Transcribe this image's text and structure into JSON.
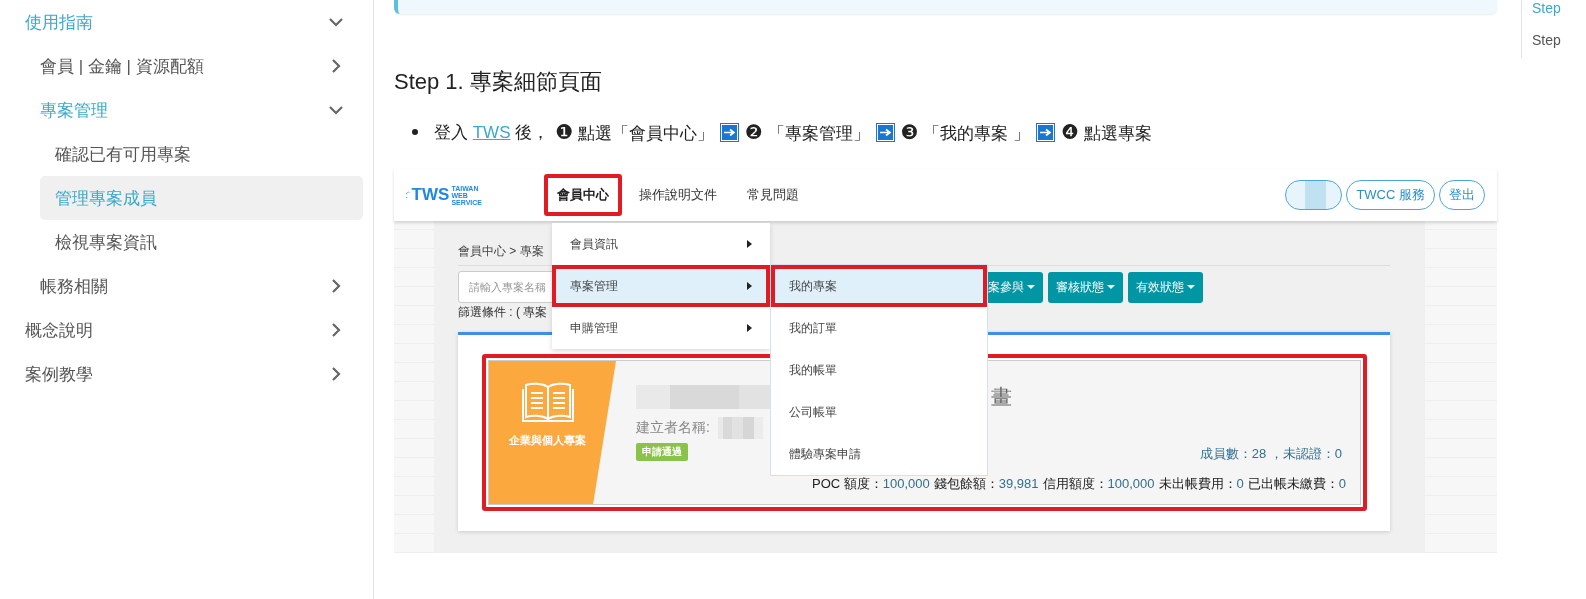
{
  "sidebar": {
    "items": [
      {
        "label": "使用指南",
        "selected": false,
        "expanded": true,
        "children": [
          {
            "label": "會員 | 金鑰 | 資源配額",
            "selected": false,
            "expanded": false
          },
          {
            "label": "專案管理",
            "selected": false,
            "expanded": true,
            "children": [
              {
                "label": "確認已有可用專案",
                "selected": false
              },
              {
                "label": "管理專案成員",
                "selected": true
              },
              {
                "label": "檢視專案資訊",
                "selected": false
              }
            ]
          },
          {
            "label": "帳務相關",
            "selected": false,
            "expanded": false
          }
        ]
      },
      {
        "label": "概念說明",
        "selected": false,
        "expanded": false
      },
      {
        "label": "案例教學",
        "selected": false,
        "expanded": false
      }
    ]
  },
  "article": {
    "heading": "Step 1. 專案細節頁面",
    "instruction": {
      "prefix": "登入 ",
      "link": "TWS",
      "suffix": " 後，",
      "steps": [
        {
          "number": "❶",
          "text": "點選「會員中心」",
          "arrow": true
        },
        {
          "number": "❷",
          "text": "「專案管理」",
          "arrow": true
        },
        {
          "number": "❸",
          "text": "「我的專案 」",
          "arrow": true
        },
        {
          "number": "❹",
          "text": "點選專案",
          "arrow": false
        }
      ]
    }
  },
  "screenshot": {
    "logo": {
      "name": "TWS",
      "tagline": [
        "TAIWAN",
        "WEB",
        "SERVICE"
      ]
    },
    "nav": [
      {
        "label": "會員中心",
        "selected": true,
        "highlighted": true
      },
      {
        "label": "操作說明文件",
        "selected": false,
        "highlighted": false
      },
      {
        "label": "常見問題",
        "selected": false,
        "highlighted": false
      }
    ],
    "account_buttons": [
      {
        "kind": "redacted"
      },
      {
        "kind": "text",
        "label": "TWCC 服務"
      },
      {
        "kind": "text",
        "label": "登出"
      }
    ],
    "breadcrumb": "會員中心 > 專案",
    "search": {
      "placeholder": "請輸入專案名稱"
    },
    "filter_buttons": [
      "案參與",
      "審核狀態",
      "有效狀態"
    ],
    "filter_summary": "篩選條件 : ( 專案",
    "menu": {
      "items": [
        {
          "label": "會員資訊",
          "selected": false,
          "highlighted": false
        },
        {
          "label": "專案管理",
          "selected": true,
          "highlighted": true
        },
        {
          "label": "申購管理",
          "selected": false,
          "highlighted": false
        }
      ]
    },
    "submenu": {
      "items": [
        {
          "label": "我的專案",
          "selected": true,
          "highlighted": true
        },
        {
          "label": "我的訂單",
          "selected": false,
          "highlighted": false
        },
        {
          "label": "我的帳單",
          "selected": false,
          "highlighted": false
        },
        {
          "label": "公司帳單",
          "selected": false,
          "highlighted": false
        },
        {
          "label": "體驗專案申請",
          "selected": false,
          "highlighted": false
        }
      ]
    },
    "project_card": {
      "highlighted": true,
      "category": "企業與個人專案",
      "title_tail": "畫",
      "creator_label": "建立者名稱:",
      "status": "申請通過",
      "members": "成員數：28 ，未認證：0",
      "stats": [
        {
          "label": "POC 額度：",
          "value": "100,000"
        },
        {
          "label": "錢包餘額：",
          "value": "39,981"
        },
        {
          "label": "信用額度：",
          "value": "100,000"
        },
        {
          "label": "未出帳費用：",
          "value": "0"
        },
        {
          "label": "已出帳未繳費：",
          "value": "0"
        }
      ]
    }
  },
  "toc": {
    "items": [
      {
        "label": "Step",
        "selected": true
      },
      {
        "label": "Step",
        "selected": false
      }
    ]
  }
}
